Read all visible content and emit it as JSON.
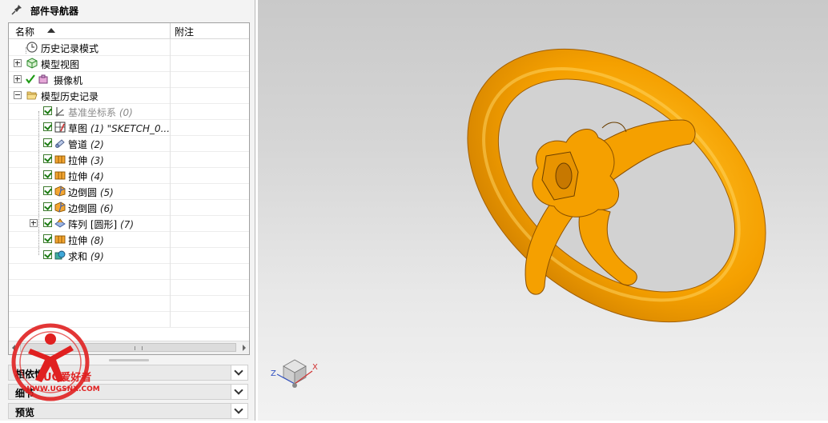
{
  "navigator": {
    "title": "部件导航器",
    "columns": {
      "name": "名称",
      "note": "附注"
    },
    "items": [
      {
        "label": "历史记录模式",
        "suffix": ""
      },
      {
        "label": "模型视图",
        "suffix": ""
      },
      {
        "label": "摄像机",
        "suffix": ""
      },
      {
        "label": "模型历史记录",
        "suffix": ""
      },
      {
        "label": "基准坐标系",
        "suffix": "(0)"
      },
      {
        "label": "草图",
        "suffix": "(1) \"SKETCH_0..."
      },
      {
        "label": "管道",
        "suffix": "(2)"
      },
      {
        "label": "拉伸",
        "suffix": "(3)"
      },
      {
        "label": "拉伸",
        "suffix": "(4)"
      },
      {
        "label": "边倒圆",
        "suffix": "(5)"
      },
      {
        "label": "边倒圆",
        "suffix": "(6)"
      },
      {
        "label": "阵列 [圆形]",
        "suffix": "(7)"
      },
      {
        "label": "拉伸",
        "suffix": "(8)"
      },
      {
        "label": "求和",
        "suffix": "(9)"
      }
    ],
    "sections": [
      {
        "label": "相依性"
      },
      {
        "label": "细节"
      },
      {
        "label": "预览"
      }
    ]
  },
  "watermark": {
    "brand": "UG爱好者",
    "url": "WWW.UGSNX.COM"
  },
  "triad": {
    "x": "X",
    "z": "Z"
  },
  "colors": {
    "model": "#f5a000",
    "model_dark": "#b06a00",
    "check": "#1e7d15",
    "logo": "#e02020"
  }
}
